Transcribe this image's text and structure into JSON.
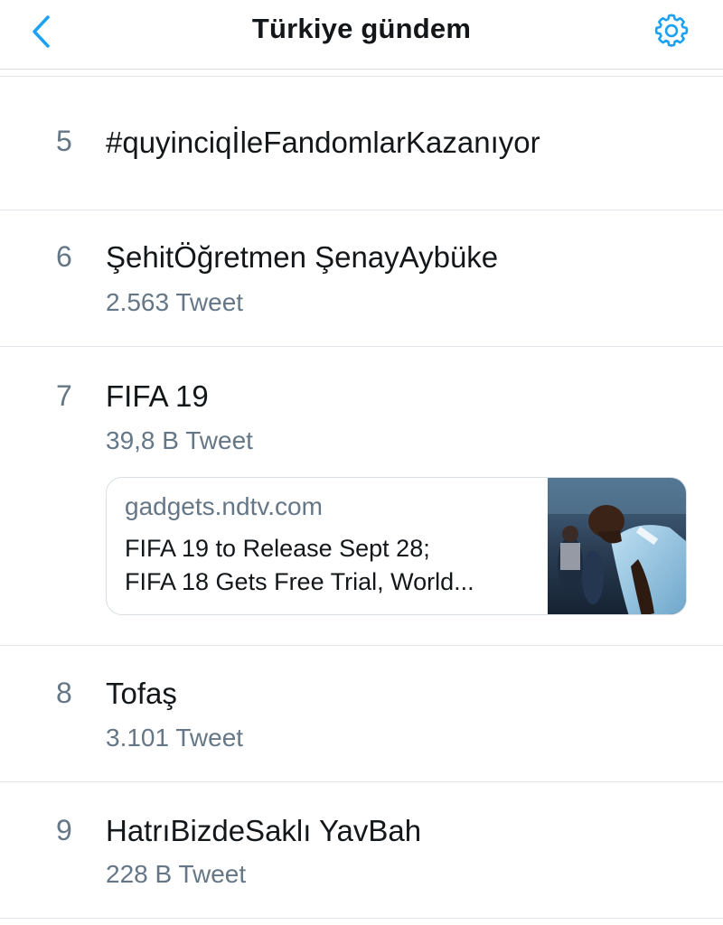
{
  "header": {
    "title": "Türkiye gündem",
    "back_icon": "chevron-left-icon",
    "settings_icon": "gear-icon",
    "accent_color": "#1da1f2"
  },
  "trends": [
    {
      "rank": "5",
      "name": "#quyinciqİleFandomlarKazanıyor",
      "count": ""
    },
    {
      "rank": "6",
      "name": "ŞehitÖğretmen ŞenayAybüke",
      "count": "2.563 Tweet"
    },
    {
      "rank": "7",
      "name": "FIFA 19",
      "count": "39,8 B Tweet",
      "card": {
        "domain": "gadgets.ndtv.com",
        "headline_line1": "FIFA 19 to Release Sept 28;",
        "headline_line2": "FIFA 18 Gets Free Trial, World..."
      }
    },
    {
      "rank": "8",
      "name": "Tofaş",
      "count": "3.101 Tweet"
    },
    {
      "rank": "9",
      "name": "HatrıBizdeSaklı YavBah",
      "count": "228 B Tweet"
    }
  ]
}
